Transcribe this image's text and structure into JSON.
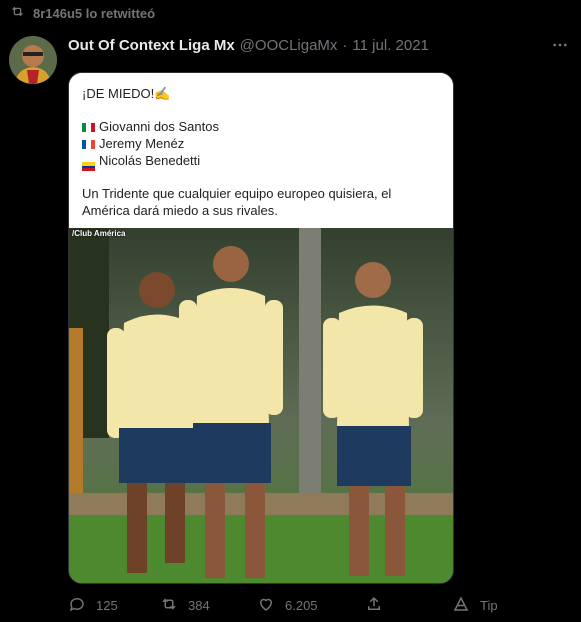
{
  "retweet": {
    "text": "8r146u5 lo retwitteó",
    "icon": "retweet-icon"
  },
  "tweet": {
    "author_name": "Out Of Context Liga Mx",
    "handle": "@OOCLigaMx",
    "separator": "·",
    "date": "11 jul. 2021",
    "more_icon": "more-icon"
  },
  "media": {
    "caption": {
      "headline": "¡DE MIEDO!✍",
      "players": [
        {
          "flag": "mexico-flag",
          "name": "Giovanni dos Santos"
        },
        {
          "flag": "france-flag",
          "name": "Jeremy Menéz"
        },
        {
          "flag": "colombia-flag",
          "name": "Nicolás Benedetti"
        }
      ],
      "body_line1": "Un Tridente que cualquier equipo europeo quisiera, el",
      "body_line2": "América dará miedo a sus rivales."
    },
    "watermark": "/Club América"
  },
  "actions": {
    "reply_count": "125",
    "retweet_count": "384",
    "like_count": "6.205",
    "tip_label": "Tip"
  },
  "colors": {
    "background": "#000000",
    "muted": "#71767b",
    "text": "#e7e9ea",
    "jersey": "#f2e7a9",
    "shorts": "#1e3a5f"
  }
}
